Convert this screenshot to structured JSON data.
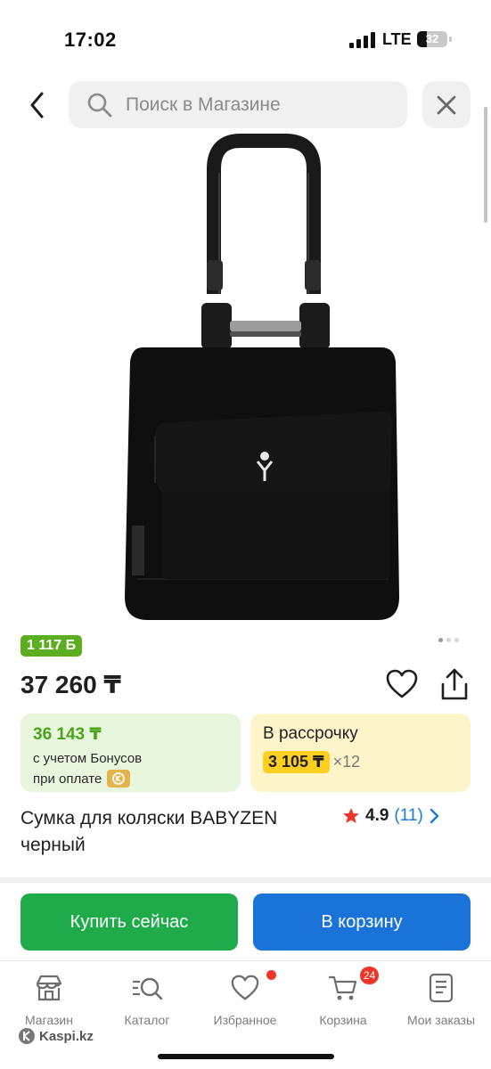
{
  "status_bar": {
    "time": "17:02",
    "network": "LTE",
    "battery": "32"
  },
  "search": {
    "placeholder": "Поиск в Магазине",
    "back_icon": "chevron-left-icon",
    "clear_icon": "close-icon"
  },
  "product": {
    "bonus_badge": "1 117 Б",
    "price": "37 260 ₸",
    "title": "Сумка для коляски BABYZEN черный",
    "image_brand": "BABYZEN",
    "gallery_pages": 3,
    "gallery_active": 0
  },
  "bonus_card": {
    "amount": "36 143 ₸",
    "line1": "с учетом Бонусов",
    "line2": "при оплате"
  },
  "installment": {
    "title": "В рассрочку",
    "amount": "3 105 ₸",
    "months": "×12"
  },
  "rating": {
    "score": "4.9",
    "count": "(11)"
  },
  "actions": {
    "buy_now": "Купить сейчас",
    "add_to_cart": "В корзину"
  },
  "tabs": [
    {
      "label": "Магазин",
      "icon": "shop-icon"
    },
    {
      "label": "Каталог",
      "icon": "catalog-search-icon"
    },
    {
      "label": "Избранное",
      "icon": "heart-icon",
      "dot": true
    },
    {
      "label": "Корзина",
      "icon": "cart-icon",
      "badge": "24"
    },
    {
      "label": "Мои заказы",
      "icon": "orders-icon"
    }
  ],
  "footer": {
    "brand": "Kaspi.kz"
  },
  "colors": {
    "bonus_green": "#5cae1e",
    "buy_green": "#1fab4a",
    "cart_blue": "#1a73d8",
    "installment_yellow": "#ffcf1f",
    "badge_red": "#f0352b",
    "link_blue": "#1a7bd6"
  }
}
